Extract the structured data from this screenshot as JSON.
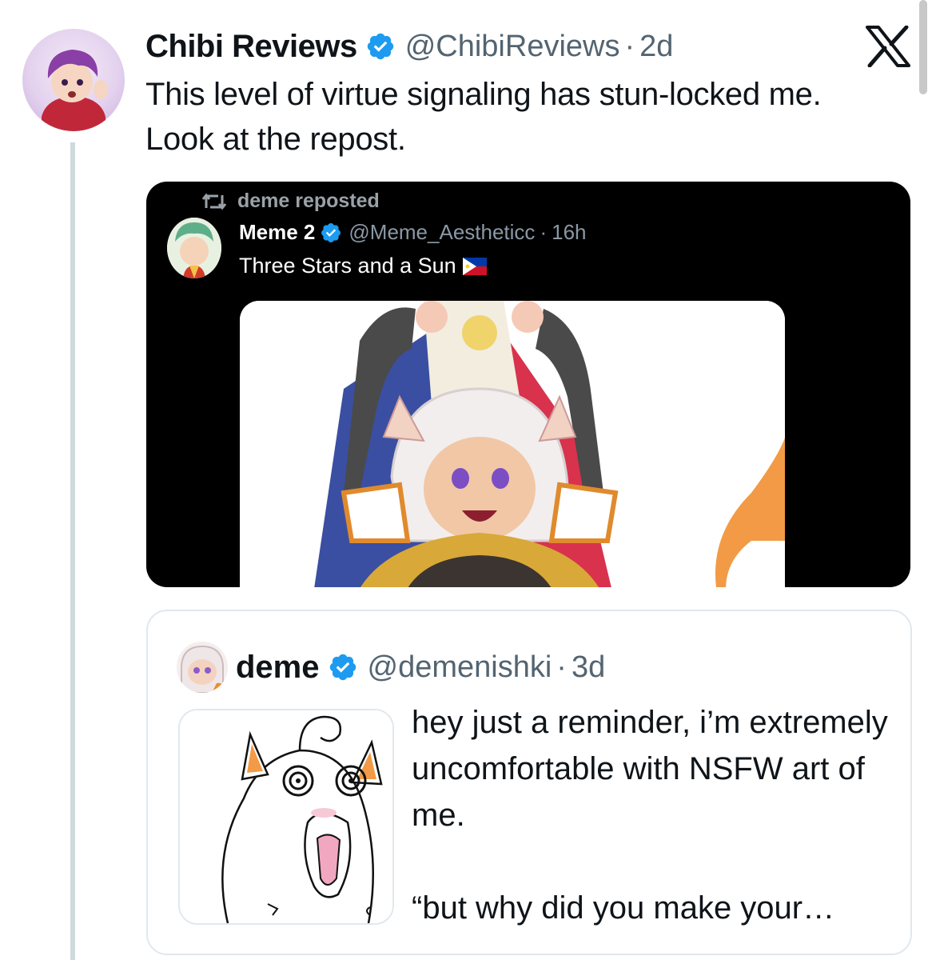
{
  "tweet": {
    "display_name": "Chibi Reviews",
    "handle": "@ChibiReviews",
    "separator": "·",
    "time": "2d",
    "text": "This level of virtue signaling has stun-locked me. Look at the repost."
  },
  "embedded_media": {
    "repost_label": "deme reposted",
    "author_name": "Meme 2",
    "author_handle": "@Meme_Aestheticc",
    "separator": "·",
    "time": "16h",
    "text": "Three Stars and a Sun"
  },
  "quoted_tweet": {
    "display_name": "deme",
    "handle": "@demenishki",
    "separator": "·",
    "time": "3d",
    "text_line_1": "hey just a reminder, i’m extremely uncomfortable with NSFW art of me.",
    "text_line_2": "“but why did you make your…"
  },
  "colors": {
    "verified_blue": "#1d9bf0",
    "secondary_text": "#536471",
    "thread_line": "#cfd9de"
  },
  "icons": [
    "verified-badge-icon",
    "x-logo-icon",
    "repost-icon",
    "philippines-flag-icon"
  ]
}
